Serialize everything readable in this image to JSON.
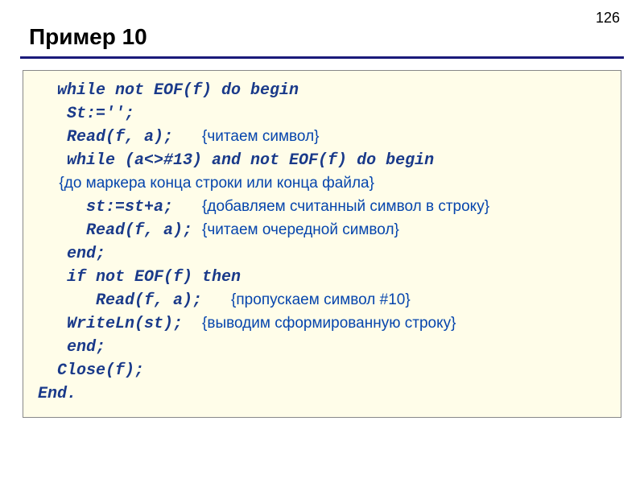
{
  "page_number": "126",
  "title": "Пример 10",
  "code": {
    "l1": "  while not EOF(f) do begin",
    "l2": "   St:='';",
    "l3a": "   Read(f, a);   ",
    "l3b": "{читаем символ}",
    "l4": "   while (a<>#13) and not EOF(f) do begin",
    "l5": "     {до маркера конца строки или конца файла}",
    "l6a": "     st:=st+a;   ",
    "l6b": "{добавляем считанный символ в строку}",
    "l7a": "     Read(f, a); ",
    "l7b": "{читаем очередной символ}",
    "l8": "   end;",
    "l9": "   if not EOF(f) then",
    "l10a": "      Read(f, a);   ",
    "l10b": "{пропускаем символ #10}",
    "l11a": "   WriteLn(st);  ",
    "l11b": "{выводим сформированную строку}",
    "l12": "   end;",
    "l13": "  Close(f);",
    "l14": "End."
  }
}
